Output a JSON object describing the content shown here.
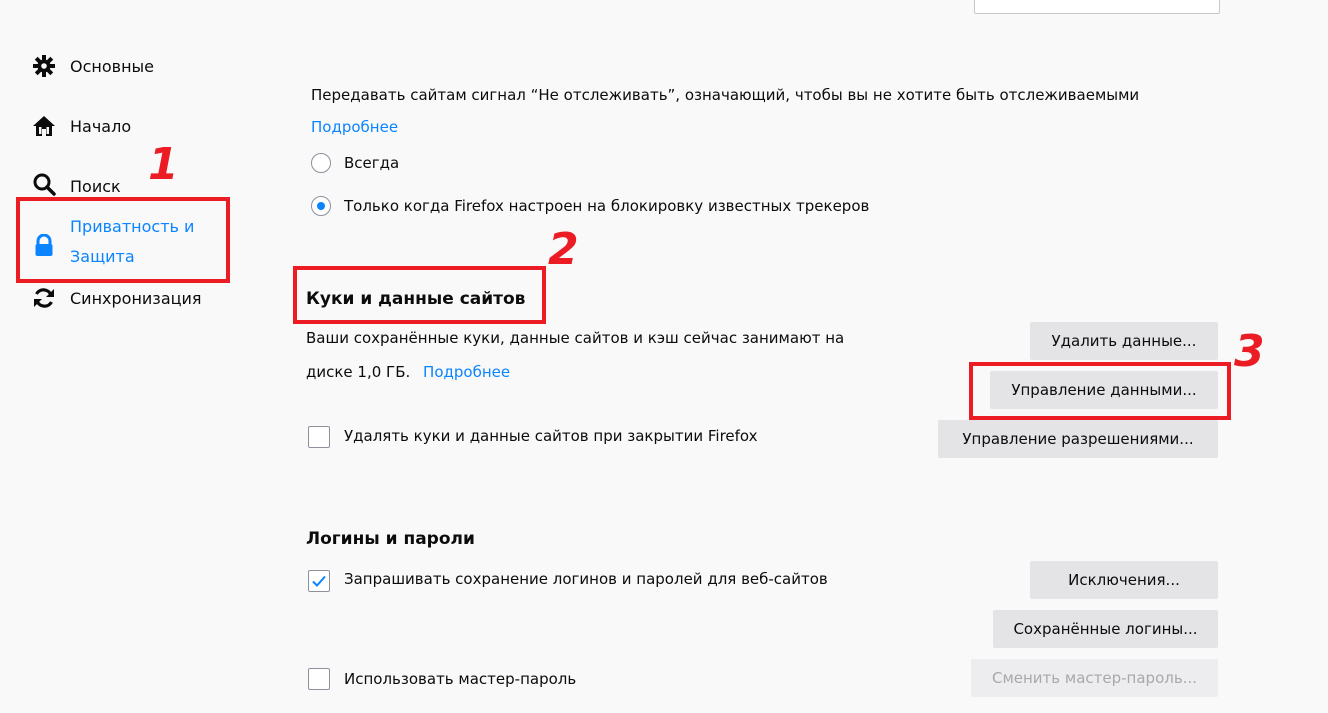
{
  "sidebar": {
    "items": [
      {
        "label": "Основные",
        "icon": "gear-icon"
      },
      {
        "label": "Начало",
        "icon": "home-icon"
      },
      {
        "label": "Поиск",
        "icon": "search-icon"
      },
      {
        "label_line1": "Приватность и",
        "label_line2": "Защита",
        "icon": "lock-icon",
        "active": true
      },
      {
        "label": "Синхронизация",
        "icon": "sync-icon"
      }
    ]
  },
  "annotations": [
    "1",
    "2",
    "3"
  ],
  "colors": {
    "accent": "#0a84ff",
    "annotation": "#ec1c24"
  },
  "dnt": {
    "description": "Передавать сайтам сигнал “Не отслеживать”, означающий, чтобы вы не хотите быть отслеживаемыми",
    "learn_more": "Подробнее",
    "options": [
      {
        "label": "Всегда",
        "checked": false
      },
      {
        "label": "Только когда Firefox настроен на блокировку известных трекеров",
        "checked": true
      }
    ]
  },
  "cookies": {
    "title": "Куки и данные сайтов",
    "description_line1": "Ваши сохранённые куки, данные сайтов и кэш сейчас занимают на",
    "description_line2": "диске 1,0 ГБ.",
    "learn_more": "Подробнее",
    "delete_on_close_label": "Удалять куки и данные сайтов при закрытии Firefox",
    "delete_on_close_checked": false,
    "buttons": {
      "clear_data": "Удалить данные...",
      "manage_data": "Управление данными...",
      "manage_permissions": "Управление разрешениями..."
    }
  },
  "logins": {
    "title": "Логины и пароли",
    "ask_save_label": "Запрашивать сохранение логинов и паролей для веб-сайтов",
    "ask_save_checked": true,
    "master_password_label": "Использовать мастер-пароль",
    "master_password_checked": false,
    "buttons": {
      "exceptions": "Исключения...",
      "saved_logins": "Сохранённые логины...",
      "change_master_password": "Сменить мастер-пароль..."
    }
  }
}
